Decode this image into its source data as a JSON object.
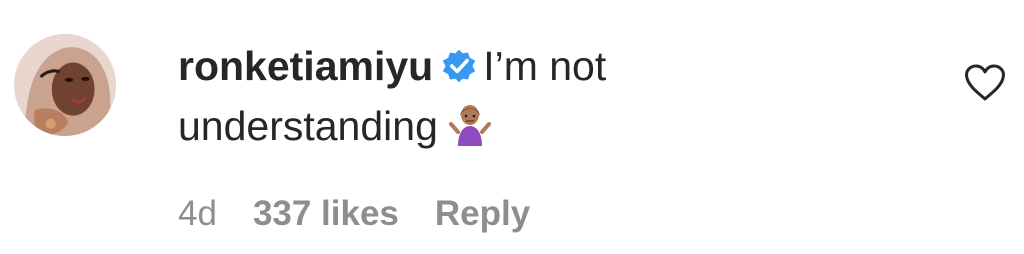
{
  "comment": {
    "username": "ronketiamiyu",
    "text_line1": "I’m not",
    "text_line2": "understanding",
    "age": "4d",
    "likes": "337 likes",
    "reply_label": "Reply"
  },
  "icons": {
    "verified": "verified-badge-icon",
    "emoji": "person-shrugging-emoji",
    "like": "heart-outline-icon"
  },
  "colors": {
    "text": "#262626",
    "meta": "#8e8e8e",
    "verified_blue": "#3897f0"
  }
}
